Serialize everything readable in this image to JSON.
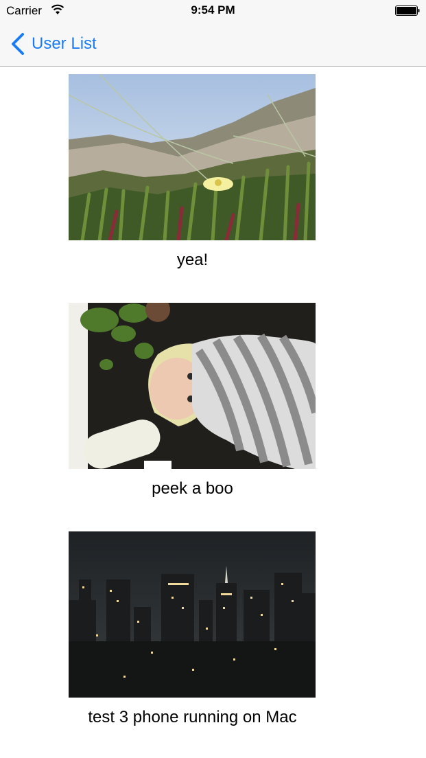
{
  "status_bar": {
    "carrier": "Carrier",
    "time": "9:54 PM",
    "wifi_icon": "wifi-icon",
    "battery_icon": "battery-full-icon"
  },
  "nav": {
    "back_label": "User List",
    "back_icon": "chevron-left-icon",
    "tint_color": "#1a7cf5"
  },
  "posts": [
    {
      "caption": "yea!",
      "photo": "beach-dune-ice-plant-flower"
    },
    {
      "caption": "peek a boo",
      "photo": "baby-in-striped-blanket"
    },
    {
      "caption": "test 3 phone running on Mac",
      "photo": "city-skyline-at-night"
    }
  ]
}
